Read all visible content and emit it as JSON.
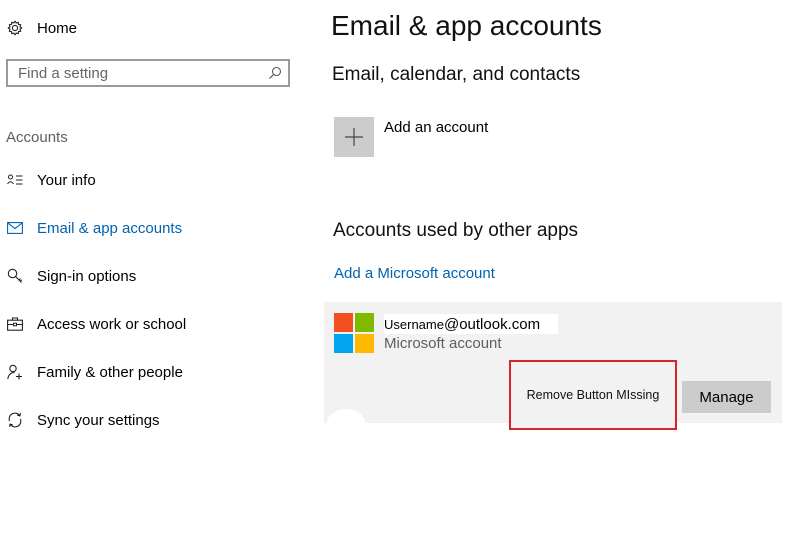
{
  "sidebar": {
    "home_label": "Home",
    "search_placeholder": "Find a setting",
    "section_title": "Accounts",
    "items": [
      {
        "label": "Your info"
      },
      {
        "label": "Email & app accounts"
      },
      {
        "label": "Sign-in options"
      },
      {
        "label": "Access work or school"
      },
      {
        "label": "Family & other people"
      },
      {
        "label": "Sync your settings"
      }
    ]
  },
  "main": {
    "title": "Email & app accounts",
    "email_section_heading": "Email, calendar, and contacts",
    "add_account_label": "Add an account",
    "other_apps_heading": "Accounts used by other apps",
    "add_ms_account_link": "Add a Microsoft account",
    "account": {
      "username": "Username",
      "domain": "@outlook.com",
      "type": "Microsoft account"
    },
    "annotation_text": "Remove Button MIssing",
    "manage_button": "Manage"
  },
  "icons": {
    "home": "gear-icon",
    "search": "search-icon",
    "your_info": "person-card-icon",
    "email": "mail-icon",
    "sign_in": "key-icon",
    "work": "briefcase-icon",
    "family": "add-person-icon",
    "sync": "sync-icon",
    "add": "plus-icon"
  },
  "colors": {
    "accent": "#0063b1",
    "annotation_border": "#d8232a",
    "ms_red": "#f25022",
    "ms_green": "#7fba00",
    "ms_blue": "#00a4ef",
    "ms_yellow": "#ffb900"
  }
}
